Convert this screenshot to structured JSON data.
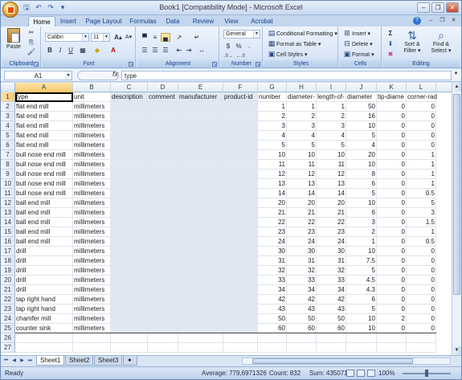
{
  "window": {
    "title": "Book1 [Compatibility Mode] - Microsoft Excel"
  },
  "ribbon_tabs": [
    "Home",
    "Insert",
    "Page Layout",
    "Formulas",
    "Data",
    "Review",
    "View",
    "Acrobat"
  ],
  "ribbon": {
    "clipboard": {
      "label": "Clipboard",
      "paste": "Paste"
    },
    "font": {
      "label": "Font",
      "font_name": "Calibri",
      "font_size": "11"
    },
    "alignment": {
      "label": "Alignment"
    },
    "number": {
      "label": "Number",
      "format": "General"
    },
    "styles": {
      "label": "Styles",
      "conditional": "Conditional Formatting",
      "format_table": "Format as Table",
      "cell_styles": "Cell Styles"
    },
    "cells": {
      "label": "Cells",
      "insert": "Insert",
      "delete": "Delete",
      "format": "Format"
    },
    "editing": {
      "label": "Editing",
      "sort": "Sort &",
      "filter": "Filter",
      "find": "Find &",
      "select": "Select"
    }
  },
  "formula_bar": {
    "name_box": "A1",
    "fx": "fx",
    "content": "type"
  },
  "columns": [
    "A",
    "B",
    "C",
    "D",
    "E",
    "F",
    "G",
    "H",
    "I",
    "J",
    "K",
    "L"
  ],
  "rows": [
    [
      "type",
      "unit",
      "description",
      "comment",
      "manufacturer",
      "product-id",
      "number",
      "diameter-",
      "length-of-",
      "diameter",
      "tip-diame",
      "corner-rad"
    ],
    [
      "flat end mill",
      "millimeters",
      "",
      "",
      "",
      "",
      "1",
      "1",
      "1",
      "50",
      "0",
      "0"
    ],
    [
      "flat end mill",
      "millimeters",
      "",
      "",
      "",
      "",
      "2",
      "2",
      "2",
      "16",
      "0",
      "0"
    ],
    [
      "flat end mill",
      "millimeters",
      "",
      "",
      "",
      "",
      "3",
      "3",
      "3",
      "10",
      "0",
      "0"
    ],
    [
      "flat end mill",
      "millimeters",
      "",
      "",
      "",
      "",
      "4",
      "4",
      "4",
      "5",
      "0",
      "0"
    ],
    [
      "flat end mill",
      "millimeters",
      "",
      "",
      "",
      "",
      "5",
      "5",
      "5",
      "4",
      "0",
      "0"
    ],
    [
      "bull nose end mill",
      "millimeters",
      "",
      "",
      "",
      "",
      "10",
      "10",
      "10",
      "20",
      "0",
      "1"
    ],
    [
      "bull nose end mill",
      "millimeters",
      "",
      "",
      "",
      "",
      "11",
      "11",
      "11",
      "10",
      "0",
      "1"
    ],
    [
      "bull nose end mill",
      "millimeters",
      "",
      "",
      "",
      "",
      "12",
      "12",
      "12",
      "8",
      "0",
      "1"
    ],
    [
      "bull nose end mill",
      "millimeters",
      "",
      "",
      "",
      "",
      "13",
      "13",
      "13",
      "6",
      "0",
      "1"
    ],
    [
      "bull nose end mill",
      "millimeters",
      "",
      "",
      "",
      "",
      "14",
      "14",
      "14",
      "5",
      "0",
      "0.5"
    ],
    [
      "ball end mill",
      "millimeters",
      "",
      "",
      "",
      "",
      "20",
      "20",
      "20",
      "10",
      "0",
      "5"
    ],
    [
      "ball end mill",
      "millimeters",
      "",
      "",
      "",
      "",
      "21",
      "21",
      "21",
      "6",
      "0",
      "3"
    ],
    [
      "ball end mill",
      "millimeters",
      "",
      "",
      "",
      "",
      "22",
      "22",
      "22",
      "3",
      "0",
      "1.5"
    ],
    [
      "ball end mill",
      "millimeters",
      "",
      "",
      "",
      "",
      "23",
      "23",
      "23",
      "2",
      "0",
      "1"
    ],
    [
      "ball end mill",
      "millimeters",
      "",
      "",
      "",
      "",
      "24",
      "24",
      "24",
      "1",
      "0",
      "0.5"
    ],
    [
      "drill",
      "millimeters",
      "",
      "",
      "",
      "",
      "30",
      "30",
      "30",
      "10",
      "0",
      "0"
    ],
    [
      "drill",
      "millimeters",
      "",
      "",
      "",
      "",
      "31",
      "31",
      "31",
      "7.5",
      "0",
      "0"
    ],
    [
      "drill",
      "millimeters",
      "",
      "",
      "",
      "",
      "32",
      "32",
      "32",
      "5",
      "0",
      "0"
    ],
    [
      "drill",
      "millimeters",
      "",
      "",
      "",
      "",
      "33",
      "33",
      "33",
      "4.5",
      "0",
      "0"
    ],
    [
      "drill",
      "millimeters",
      "",
      "",
      "",
      "",
      "34",
      "34",
      "34",
      "4.3",
      "0",
      "0"
    ],
    [
      "tap right hand",
      "millimeters",
      "",
      "",
      "",
      "",
      "42",
      "42",
      "42",
      "6",
      "0",
      "0"
    ],
    [
      "tap right hand",
      "millimeters",
      "",
      "",
      "",
      "",
      "43",
      "43",
      "43",
      "5",
      "0",
      "0"
    ],
    [
      "chamfer mill",
      "millimeters",
      "",
      "",
      "",
      "",
      "50",
      "50",
      "50",
      "10",
      "2",
      "0"
    ],
    [
      "counter sink",
      "millimeters",
      "",
      "",
      "",
      "",
      "60",
      "60",
      "60",
      "10",
      "0",
      "0"
    ],
    [
      "",
      "",
      "",
      "",
      "",
      "",
      "",
      "",
      "",
      "",
      "",
      ""
    ],
    [
      "",
      "",
      "",
      "",
      "",
      "",
      "",
      "",
      "",
      "",
      "",
      ""
    ]
  ],
  "sheet_tabs": [
    "Sheet1",
    "Sheet2",
    "Sheet3"
  ],
  "status": {
    "ready": "Ready",
    "average": "Average: 779,6971326",
    "count": "Count: 832",
    "sum": "Sum: 435071",
    "zoom": "100%"
  }
}
